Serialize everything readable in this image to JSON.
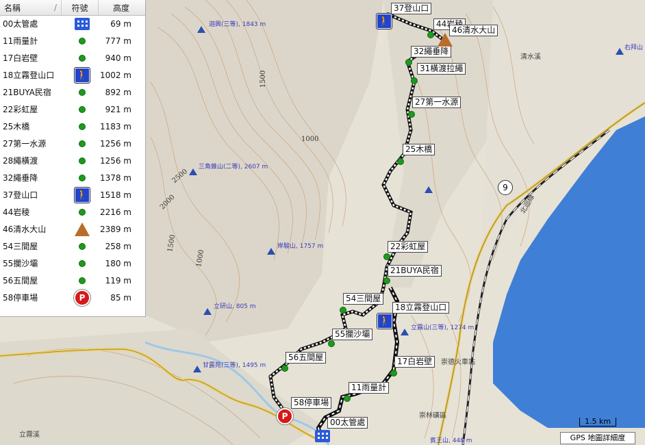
{
  "panel": {
    "col_name": "名稱",
    "col_sort": "/",
    "col_symbol": "符號",
    "col_alt": "高度",
    "rows": [
      {
        "name": "00太管處",
        "icon": "building-icon",
        "alt": "69 m"
      },
      {
        "name": "11雨量計",
        "icon": "green-dot-icon",
        "alt": "777 m"
      },
      {
        "name": "17白岩壁",
        "icon": "green-dot-icon",
        "alt": "940 m"
      },
      {
        "name": "18立霧登山口",
        "icon": "hiker-icon",
        "alt": "1002 m"
      },
      {
        "name": "21BUYA民宿",
        "icon": "green-dot-icon",
        "alt": "892 m"
      },
      {
        "name": "22彩虹屋",
        "icon": "green-dot-icon",
        "alt": "921 m"
      },
      {
        "name": "25木橋",
        "icon": "green-dot-icon",
        "alt": "1183 m"
      },
      {
        "name": "27第一水源",
        "icon": "green-dot-icon",
        "alt": "1256 m"
      },
      {
        "name": "28繩橫渡",
        "icon": "green-dot-icon",
        "alt": "1256 m"
      },
      {
        "name": "32繩垂降",
        "icon": "green-dot-icon",
        "alt": "1378 m"
      },
      {
        "name": "37登山口",
        "icon": "hiker-icon",
        "alt": "1518 m"
      },
      {
        "name": "44岩稜",
        "icon": "green-dot-icon",
        "alt": "2216 m"
      },
      {
        "name": "46清水大山",
        "icon": "peak-icon",
        "alt": "2389 m"
      },
      {
        "name": "54三間屋",
        "icon": "green-dot-icon",
        "alt": "258 m"
      },
      {
        "name": "55攔沙壩",
        "icon": "green-dot-icon",
        "alt": "180 m"
      },
      {
        "name": "56五間屋",
        "icon": "green-dot-icon",
        "alt": "119 m"
      },
      {
        "name": "58停車場",
        "icon": "parking-icon",
        "alt": "85 m"
      }
    ]
  },
  "map": {
    "waypoint_labels": [
      {
        "text": "37登山口"
      },
      {
        "text": "44岩稜"
      },
      {
        "text": "46清水大山"
      },
      {
        "text": "32繩垂降"
      },
      {
        "text": "31橫渡拉繩"
      },
      {
        "text": "27第一水源"
      },
      {
        "text": "25木橋"
      },
      {
        "text": "22彩虹屋"
      },
      {
        "text": "21BUYA民宿"
      },
      {
        "text": "18立霧登山口"
      },
      {
        "text": "54三間屋"
      },
      {
        "text": "55攔沙壩"
      },
      {
        "text": "56五間屋"
      },
      {
        "text": "17白岩壁"
      },
      {
        "text": "11雨量計"
      },
      {
        "text": "58停車場"
      },
      {
        "text": "00太管處"
      }
    ],
    "peaks": [
      {
        "text": "迦興(三等), 1843 m"
      },
      {
        "text": "三角錐山(二等), 2607 m"
      },
      {
        "text": "岸駿山, 1757 m"
      },
      {
        "text": "立研山, 805 m"
      },
      {
        "text": "立霧山(三等), 1274 m"
      },
      {
        "text": "甘露苑(三等), 1495 m"
      },
      {
        "text": "賓王山, 448 m"
      },
      {
        "text": "右拜山"
      }
    ],
    "contours": [
      "1500",
      "1000",
      "2500",
      "2000",
      "1500",
      "1000"
    ],
    "road_shield": "9",
    "place_labels": [
      "清水溪",
      "立霧溪",
      "崇德火車站",
      "崇林礦區",
      "北迴線"
    ],
    "scale_text": "1.5 km",
    "detail_text": "GPS 地圖詳細度"
  }
}
